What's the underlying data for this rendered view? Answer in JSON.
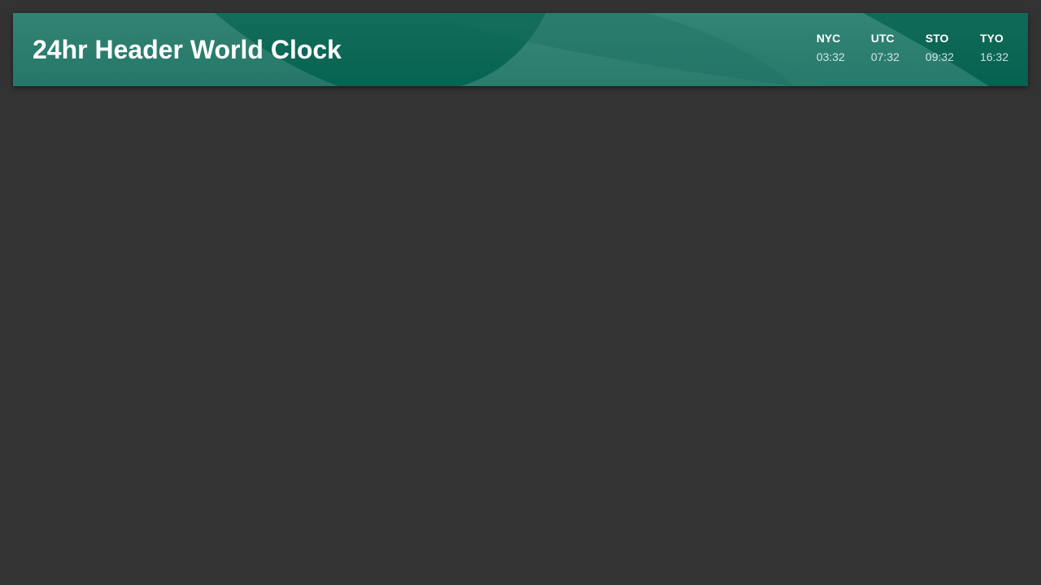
{
  "header": {
    "title": "24hr Header World Clock",
    "colors": {
      "page_background": "#333333",
      "header_light": "#2b7f6e",
      "header_dark": "#005e4a",
      "text": "#ffffff"
    }
  },
  "clocks": [
    {
      "city": "NYC",
      "time": "03:32"
    },
    {
      "city": "UTC",
      "time": "07:32"
    },
    {
      "city": "STO",
      "time": "09:32"
    },
    {
      "city": "TYO",
      "time": "16:32"
    }
  ]
}
